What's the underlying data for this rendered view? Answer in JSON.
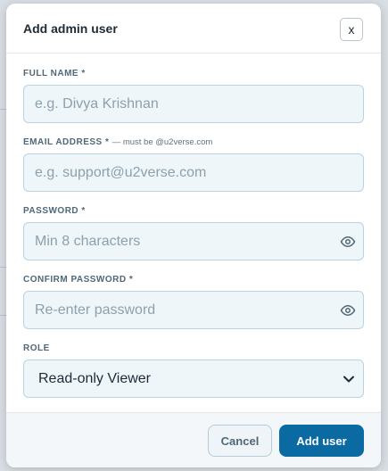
{
  "modal": {
    "title": "Add admin user",
    "close_label": "x"
  },
  "form": {
    "full_name": {
      "label": "FULL NAME *",
      "placeholder": "e.g. Divya Krishnan",
      "value": ""
    },
    "email": {
      "label": "EMAIL ADDRESS *",
      "hint": "— must be @u2verse.com",
      "placeholder": "e.g. support@u2verse.com",
      "value": ""
    },
    "password": {
      "label": "PASSWORD *",
      "placeholder": "Min 8 characters",
      "value": "",
      "icon": "eye-icon"
    },
    "confirm_password": {
      "label": "CONFIRM PASSWORD *",
      "placeholder": "Re-enter password",
      "value": "",
      "icon": "eye-icon"
    },
    "role": {
      "label": "ROLE",
      "selected": "Read-only Viewer"
    }
  },
  "footer": {
    "cancel_label": "Cancel",
    "submit_label": "Add user"
  },
  "colors": {
    "primary": "#0b6aa2",
    "input_bg": "#eef6fa",
    "input_border": "#b8d4e2",
    "label": "#4f6878"
  }
}
